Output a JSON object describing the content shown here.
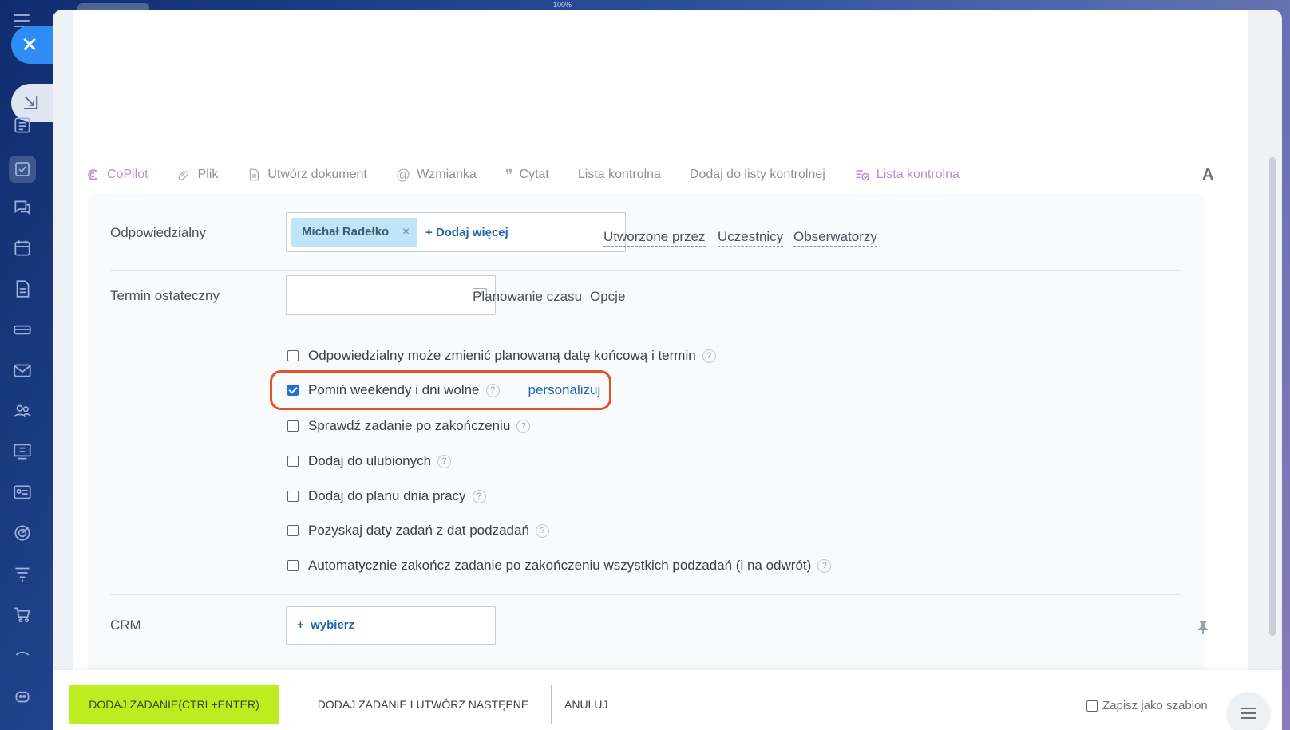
{
  "window": {
    "zoom": "100%"
  },
  "toolbar": {
    "copilot": "CoPilot",
    "file": "Plik",
    "create_doc": "Utwórz dokument",
    "mention": "Wzmianka",
    "quote": "Cytat",
    "checklist": "Lista kontrolna",
    "add_checklist": "Dodaj do listy kontrolnej",
    "checklist2": "Lista kontrolna",
    "font": "A"
  },
  "form": {
    "responsible_label": "Odpowiedzialny",
    "responsible_user": "Michał Radełko",
    "add_more": "Dodaj więcej",
    "created_by": "Utworzone przez",
    "participants": "Uczestnicy",
    "observers": "Obserwatorzy",
    "deadline_label": "Termin ostateczny",
    "deadline_value": "",
    "time_planning": "Planowanie czasu",
    "options": "Opcje",
    "crm_label": "CRM",
    "crm_select": "wybierz",
    "personalize": "personalizuj",
    "options_list": [
      {
        "label": "Odpowiedzialny może zmienić planowaną datę końcową i termin",
        "checked": false
      },
      {
        "label": "Pomiń weekendy i dni wolne",
        "checked": true
      },
      {
        "label": "Sprawdź zadanie po zakończeniu",
        "checked": false
      },
      {
        "label": "Dodaj do ulubionych",
        "checked": false
      },
      {
        "label": "Dodaj do planu dnia pracy",
        "checked": false
      },
      {
        "label": "Pozyskaj daty zadań z dat podzadań",
        "checked": false
      },
      {
        "label": "Automatycznie zakończ zadanie po zakończeniu wszystkich podzadań (i na odwrót)",
        "checked": false
      }
    ]
  },
  "footer": {
    "add_task": "DODAJ ZADANIE(CTRL+ENTER)",
    "add_and_next": "DODAJ ZADANIE I UTWÓRZ NASTĘPNE",
    "cancel": "ANULUJ",
    "save_template": "Zapisz jako szablon"
  },
  "colors": {
    "accent": "#2f8cf5",
    "primary_button": "#bbed21",
    "highlight": "#e0532a",
    "link": "#2067b0"
  }
}
